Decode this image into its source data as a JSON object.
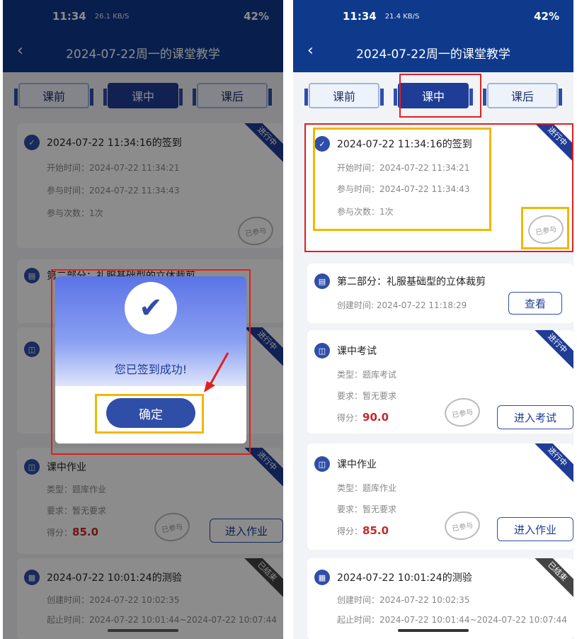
{
  "status": {
    "time": "11:34",
    "speed_left": "26.1 KB/S",
    "speed_right": "21.4 KB/S",
    "battery": "42%"
  },
  "header": {
    "back_icon": "chevron-left-icon",
    "title": "2024-07-22周一的课堂教学"
  },
  "tabs": [
    "课前",
    "课中",
    "课后"
  ],
  "cards": {
    "checkin": {
      "title": "2024-07-22 11:34:16的签到",
      "start": "开始时间：2024-07-22 11:34:21",
      "join": "参与时间：2024-07-22 11:34:43",
      "count": "参与次数：1次",
      "ribbon": "进行中",
      "stamp": "已参与"
    },
    "part2": {
      "title": "第二部分：礼服基础型的立体裁剪",
      "created": "创建时间: 2024-07-22 11:18:29",
      "button": "查看"
    },
    "exam": {
      "title": "课中考试",
      "type": "类型：题库考试",
      "req": "要求：暂无要求",
      "score_label": "得分：",
      "score": "90.0",
      "ribbon": "进行中",
      "stamp": "已参与",
      "button": "进入考试"
    },
    "homework": {
      "title": "课中作业",
      "type": "类型：题库作业",
      "req": "要求：暂无要求",
      "score_label": "得分：",
      "score": "85.0",
      "ribbon": "进行中",
      "stamp": "已参与",
      "button": "进入作业"
    },
    "quiz": {
      "title": "2024-07-22 10:01:24的测验",
      "created": "创建时间：2024-07-22 10:02:35",
      "period": "起止时间：2024-07-22 10:01:44~2024-07-22 10:07:44",
      "ribbon": "已结束"
    }
  },
  "modal": {
    "message": "您已签到成功!",
    "confirm": "确定",
    "icon": "check-icon"
  },
  "colors": {
    "primary": "#1f3c96",
    "highlight_red": "#e02020",
    "highlight_yellow": "#f0b800",
    "score": "#c62828"
  }
}
